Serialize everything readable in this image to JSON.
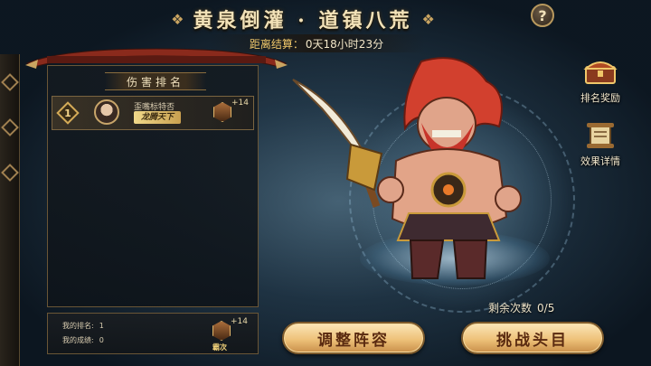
{
  "header": {
    "title": "黄泉倒灌 · 道镇八荒",
    "countdown_label": "距离结算：",
    "countdown_value": "0天18小时23分",
    "help_label": "?"
  },
  "ranking": {
    "header": "伤害排名",
    "rows": [
      {
        "rank": "1",
        "name": "歪嘴标特否",
        "title": "龙腾天下",
        "badge_plus": "+14"
      }
    ]
  },
  "my_stats": {
    "rank_label": "我的排名:",
    "rank_value": "1",
    "score_label": "我的成绩:",
    "score_value": "0",
    "badge_plus": "+14",
    "badge_caption": "霸次"
  },
  "side_buttons": {
    "rank_reward": "排名奖励",
    "effect_detail": "效果详情"
  },
  "remaining": {
    "label": "剩余次数",
    "value": "0/5"
  },
  "actions": {
    "adjust": "调整阵容",
    "challenge": "挑战头目"
  },
  "colors": {
    "gold": "#f0c76a",
    "button_gradient_top": "#fbe6b8",
    "button_text": "#5a2a10"
  }
}
